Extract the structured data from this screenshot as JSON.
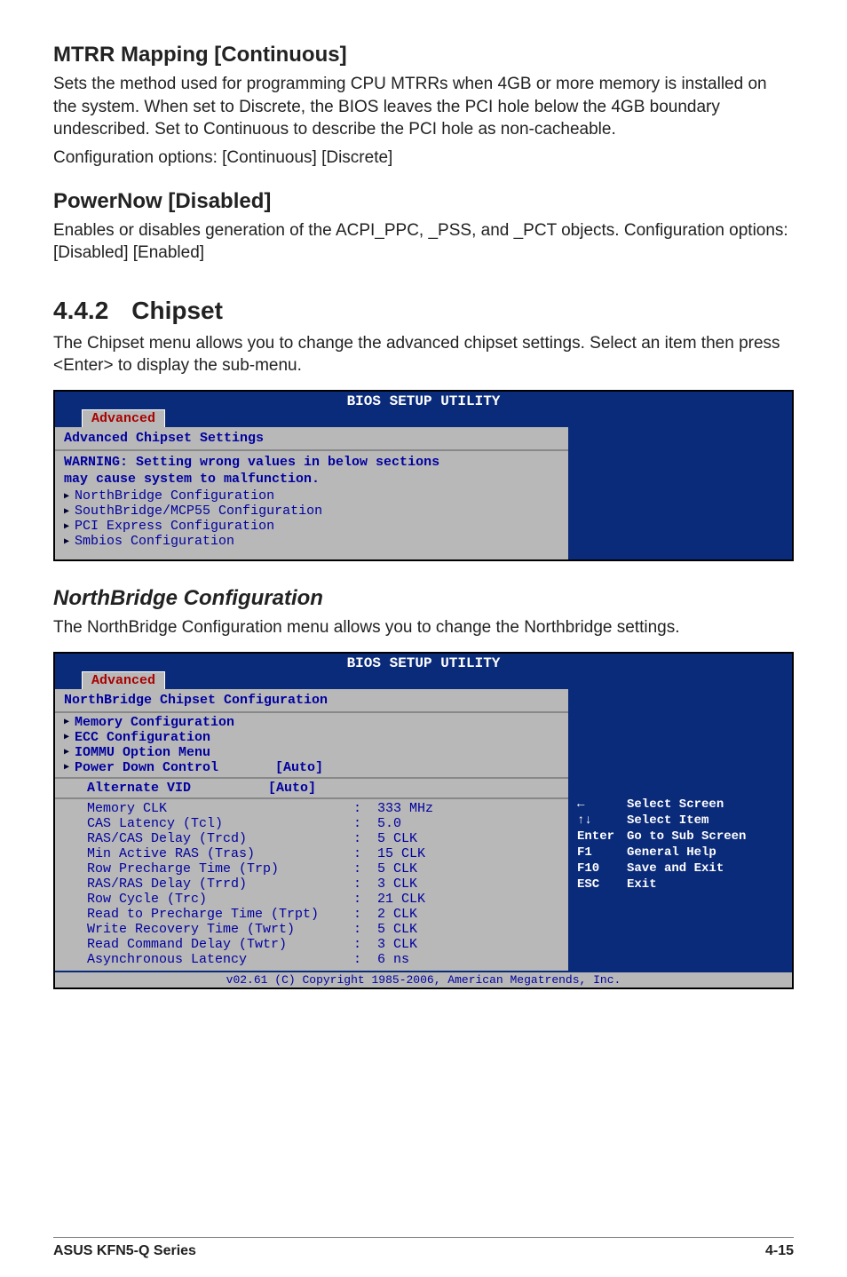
{
  "section1": {
    "title": "MTRR Mapping [Continuous]",
    "p1": "Sets the method used for programming CPU MTRRs when 4GB or more memory is installed on the system. When set to Discrete, the BIOS leaves the PCI hole below the 4GB boundary undescribed. Set to Continuous to describe the PCI hole as non-cacheable.",
    "p2": "Configuration options: [Continuous] [Discrete]"
  },
  "section2": {
    "title": "PowerNow [Disabled]",
    "p1": "Enables or disables generation of the ACPI_PPC, _PSS, and _PCT objects. Configuration options: [Disabled] [Enabled]"
  },
  "section3": {
    "num": "4.4.2",
    "title": "Chipset",
    "p1": "The Chipset menu allows you to change the advanced chipset settings. Select an item then press <Enter> to display the sub-menu."
  },
  "bios1": {
    "app_title": "BIOS SETUP UTILITY",
    "tab": "Advanced",
    "section_title": "Advanced Chipset Settings",
    "warn_line1": "WARNING: Setting wrong values in below sections",
    "warn_line2": "         may cause system to malfunction.",
    "items": [
      "NorthBridge Configuration",
      "SouthBridge/MCP55 Configuration",
      "PCI Express Configuration",
      "Smbios Configuration"
    ]
  },
  "section4": {
    "title": "NorthBridge Configuration",
    "p1": "The NorthBridge Configuration menu allows you to change the Northbridge settings."
  },
  "bios2": {
    "app_title": "BIOS SETUP UTILITY",
    "tab": "Advanced",
    "section_title": "NorthBridge Chipset Configuration",
    "menu_items": [
      "Memory Configuration",
      "ECC Configuration",
      "IOMMU Option Menu"
    ],
    "power_label": "Power Down Control",
    "power_val": "[Auto]",
    "alt_label": "Alternate VID",
    "alt_val": "[Auto]",
    "readouts": [
      {
        "label": "Memory CLK",
        "val": ":  333 MHz"
      },
      {
        "label": "CAS Latency (Tcl)",
        "val": ":  5.0"
      },
      {
        "label": "RAS/CAS Delay (Trcd)",
        "val": ":  5 CLK"
      },
      {
        "label": "Min Active RAS (Tras)",
        "val": ":  15 CLK"
      },
      {
        "label": "Row Precharge Time (Trp)",
        "val": ":  5 CLK"
      },
      {
        "label": "RAS/RAS Delay (Trrd)",
        "val": ":  3 CLK"
      },
      {
        "label": "Row Cycle (Trc)",
        "val": ":  21 CLK"
      },
      {
        "label": "Read to Precharge Time (Trpt)",
        "val": ":  2 CLK"
      },
      {
        "label": "Write Recovery Time (Twrt)",
        "val": ":  5 CLK"
      },
      {
        "label": "Read Command Delay (Twtr)",
        "val": ":  3 CLK"
      },
      {
        "label": "Asynchronous Latency",
        "val": ":  6 ns"
      }
    ],
    "help": {
      "left_arrows": "←",
      "updown": "↑↓",
      "select_screen": "Select Screen",
      "select_item": "Select Item",
      "enter": "Enter",
      "goto_sub": "Go to Sub Screen",
      "f1": "F1",
      "general_help": "General Help",
      "f10": "F10",
      "save_exit": "Save and Exit",
      "esc": "ESC",
      "exit": "Exit"
    },
    "footer": "v02.61 (C) Copyright 1985-2006, American Megatrends, Inc."
  },
  "footer": {
    "left": "ASUS KFN5-Q Series",
    "right": "4-15"
  }
}
